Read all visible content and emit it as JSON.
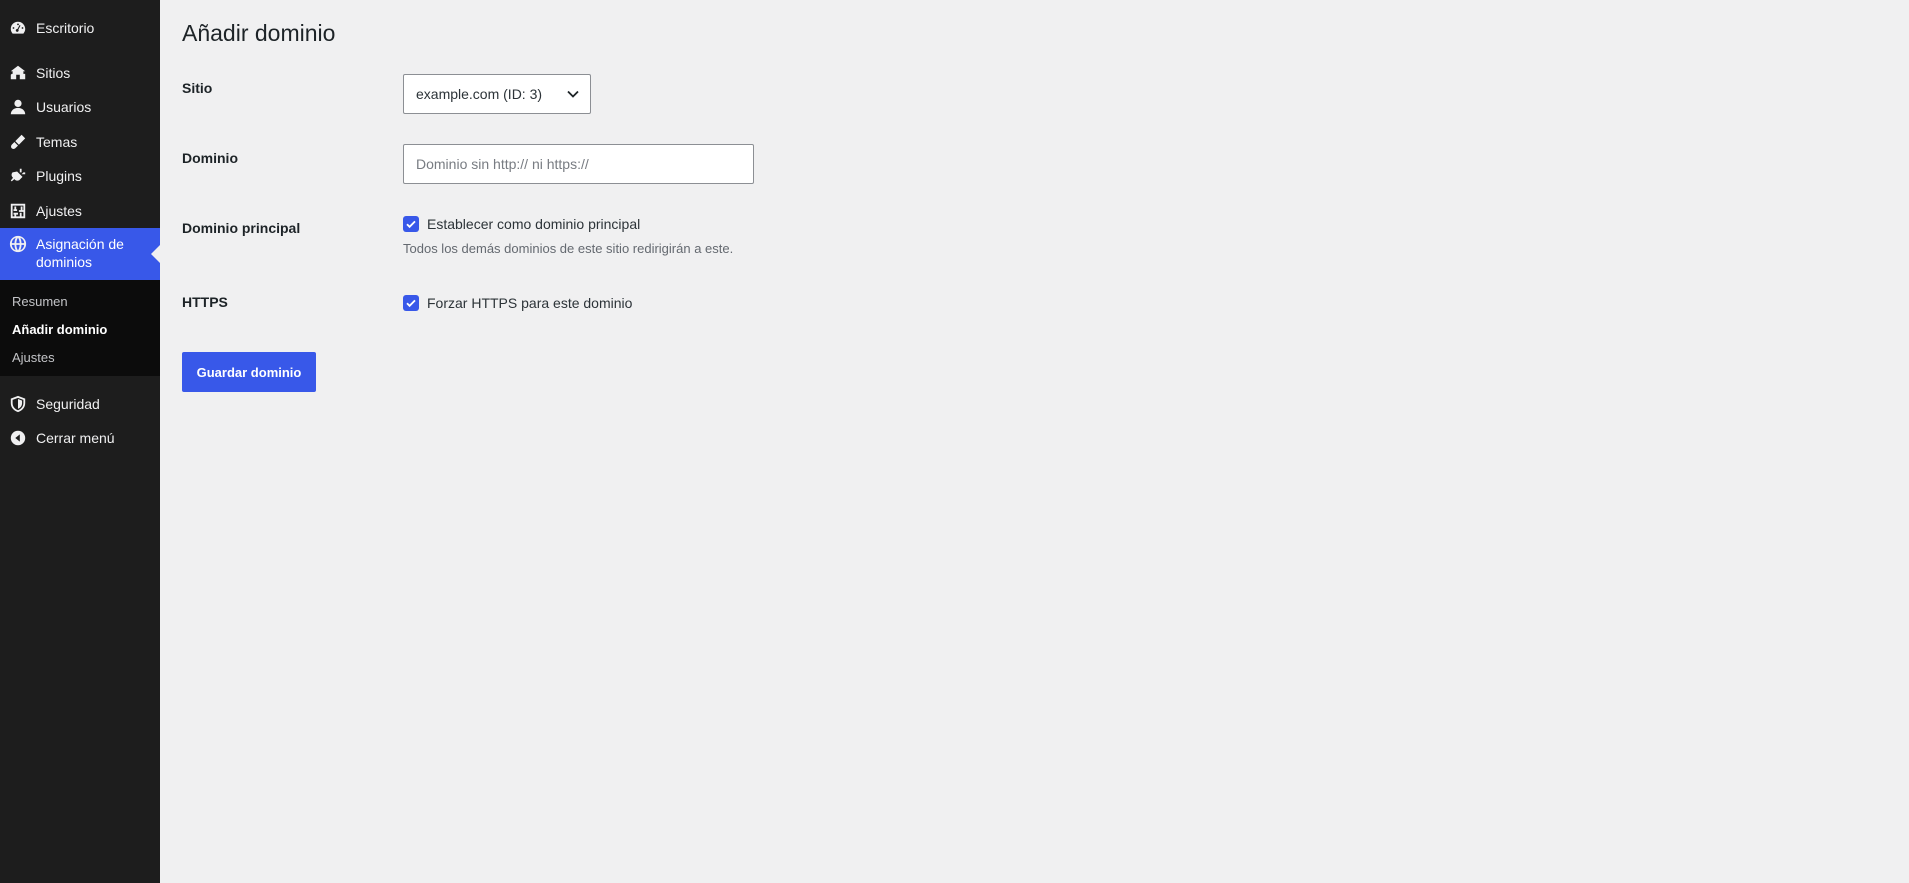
{
  "sidebar": {
    "items": [
      {
        "label": "Escritorio",
        "icon": "dashboard-icon"
      },
      {
        "label": "Sitios",
        "icon": "sites-icon"
      },
      {
        "label": "Usuarios",
        "icon": "users-icon"
      },
      {
        "label": "Temas",
        "icon": "themes-icon"
      },
      {
        "label": "Plugins",
        "icon": "plugins-icon"
      },
      {
        "label": "Ajustes",
        "icon": "settings-icon"
      },
      {
        "label": "Asignación de dominios",
        "icon": "globe-icon"
      },
      {
        "label": "Seguridad",
        "icon": "shield-icon"
      },
      {
        "label": "Cerrar menú",
        "icon": "collapse-icon"
      }
    ],
    "submenu": [
      {
        "label": "Resumen"
      },
      {
        "label": "Añadir dominio"
      },
      {
        "label": "Ajustes"
      }
    ]
  },
  "page": {
    "title": "Añadir dominio"
  },
  "form": {
    "site": {
      "label": "Sitio",
      "selected": "example.com (ID: 3)"
    },
    "domain": {
      "label": "Dominio",
      "placeholder": "Dominio sin http:// ni https://",
      "value": ""
    },
    "primary": {
      "label": "Dominio principal",
      "checkbox_label": "Establecer como dominio principal",
      "checked": true,
      "description": "Todos los demás dominios de este sitio redirigirán a este."
    },
    "https": {
      "label": "HTTPS",
      "checkbox_label": "Forzar HTTPS para este dominio",
      "checked": true
    },
    "save_label": "Guardar dominio"
  },
  "colors": {
    "sidebar_bg": "#1d1d1d",
    "accent": "#3858e9",
    "page_bg": "#f0f0f1"
  }
}
